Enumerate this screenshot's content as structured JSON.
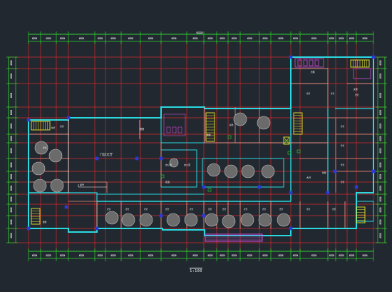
{
  "drawing": {
    "title": "1:100",
    "labels": {
      "hall": "门诊大厅",
      "pharmacy": "药房",
      "registration": "挂号",
      "corridor": "走道",
      "office": "办公室",
      "stair": "楼梯",
      "toilet_m": "男厕",
      "toilet_f": "女厕",
      "waiting": "候诊",
      "clinic": "诊室",
      "hall_right": "大厅",
      "lab": "化验"
    }
  },
  "colors": {
    "background": "#212830",
    "grid_red": "#d62a2a",
    "dim_green": "#2fd52f",
    "wall_cyan": "#2bd9e0",
    "partition_salmon": "#e98d7c",
    "magenta": "#d24ad8",
    "yellow": "#e8e82a",
    "blue_column": "#2a3ad8",
    "white": "#ffffff"
  }
}
